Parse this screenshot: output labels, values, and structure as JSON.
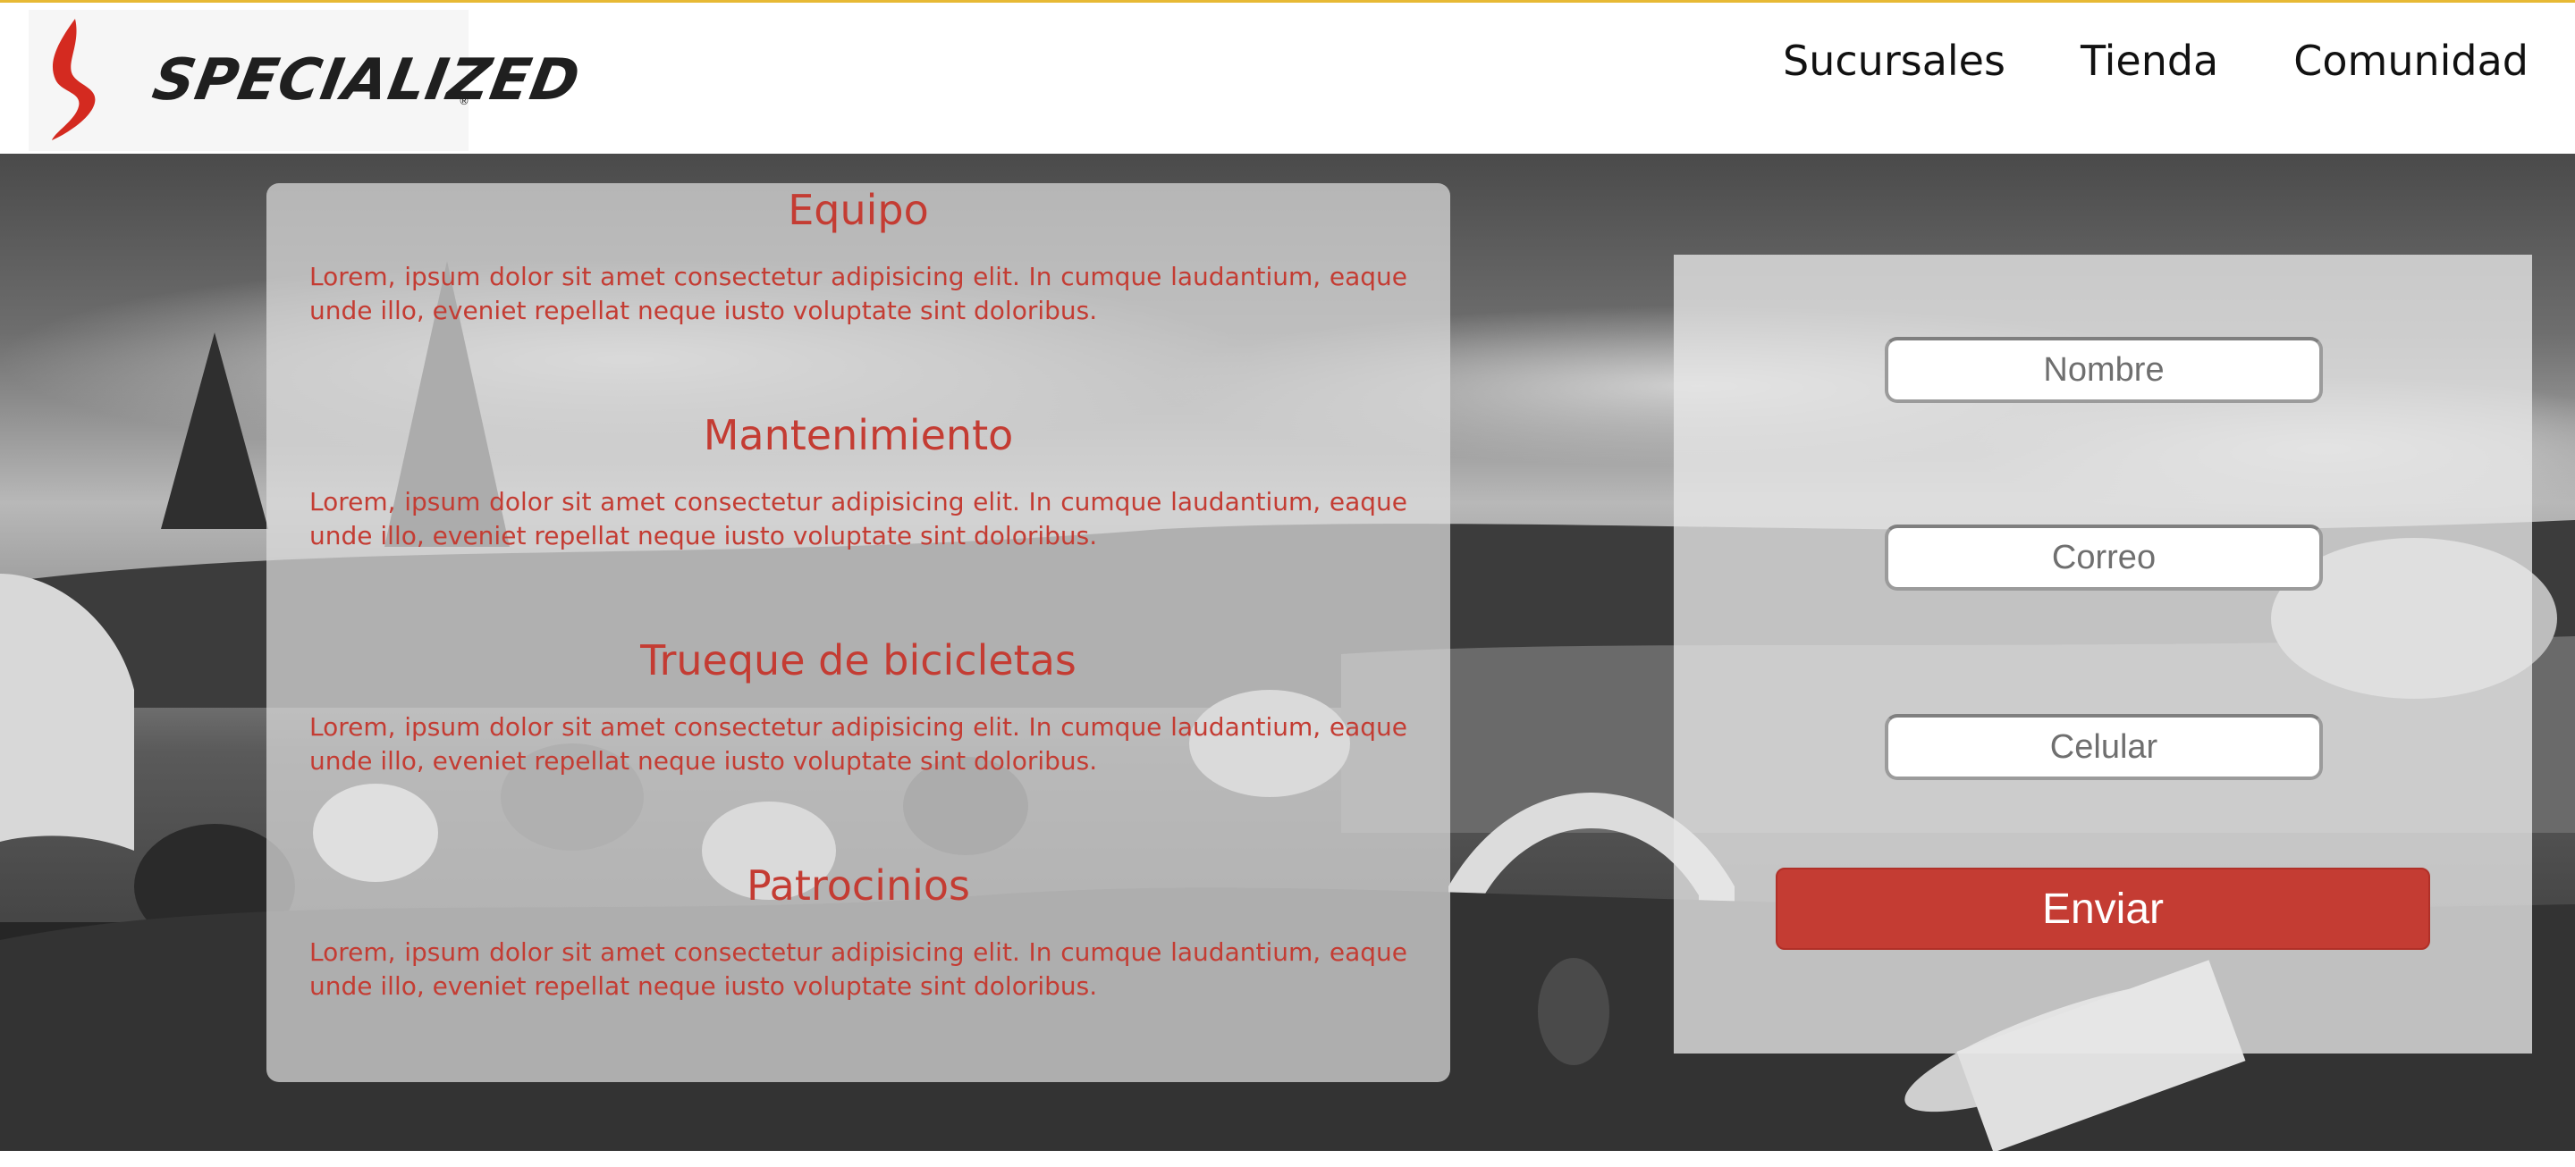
{
  "header": {
    "brand": "SPECIALIZED",
    "brand_registered": "®",
    "nav": [
      "Sucursales",
      "Tienda",
      "Comunidad"
    ]
  },
  "info": {
    "sections": [
      {
        "title": "Equipo",
        "text": "Lorem, ipsum dolor sit amet consectetur adipisicing elit. In cumque laudantium, eaque unde illo, eveniet repellat neque iusto voluptate sint doloribus."
      },
      {
        "title": "Mantenimiento",
        "text": "Lorem, ipsum dolor sit amet consectetur adipisicing elit. In cumque laudantium, eaque unde illo, eveniet repellat neque iusto voluptate sint doloribus."
      },
      {
        "title": "Trueque de bicicletas",
        "text": "Lorem, ipsum dolor sit amet consectetur adipisicing elit. In cumque laudantium, eaque unde illo, eveniet repellat neque iusto voluptate sint doloribus."
      },
      {
        "title": "Patrocinios",
        "text": "Lorem, ipsum dolor sit amet consectetur adipisicing elit. In cumque laudantium, eaque unde illo, eveniet repellat neque iusto voluptate sint doloribus."
      }
    ]
  },
  "form": {
    "name_placeholder": "Nombre",
    "email_placeholder": "Correo",
    "phone_placeholder": "Celular",
    "submit_label": "Enviar"
  },
  "colors": {
    "accent": "#c43c33",
    "header_border": "#e7b934"
  },
  "icons": {
    "logo": "specialized-s-logo-icon"
  }
}
